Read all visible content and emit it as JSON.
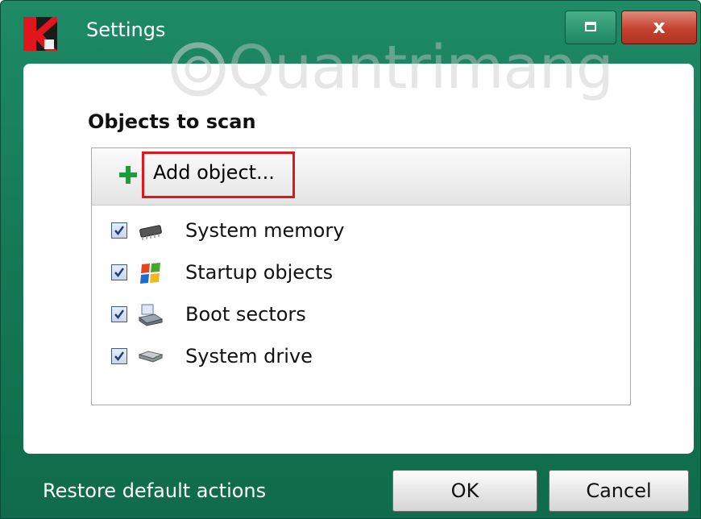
{
  "window": {
    "title": "Settings",
    "close_label": "x",
    "watermark_text": "Quantrimang"
  },
  "section": {
    "title": "Objects to scan"
  },
  "list": {
    "add_label": "Add object...",
    "items": [
      {
        "label": "System memory",
        "icon": "memory-chip-icon",
        "checked": true
      },
      {
        "label": "Startup objects",
        "icon": "windows-logo-icon",
        "checked": true
      },
      {
        "label": "Boot sectors",
        "icon": "boot-sector-icon",
        "checked": true
      },
      {
        "label": "System drive",
        "icon": "hard-drive-icon",
        "checked": true
      }
    ]
  },
  "footer": {
    "restore_label": "Restore default actions",
    "ok_label": "OK",
    "cancel_label": "Cancel"
  },
  "colors": {
    "frame": "#167a57",
    "highlight": "#e0161c",
    "add_icon": "#1c9b3f",
    "close": "#c5412f"
  }
}
